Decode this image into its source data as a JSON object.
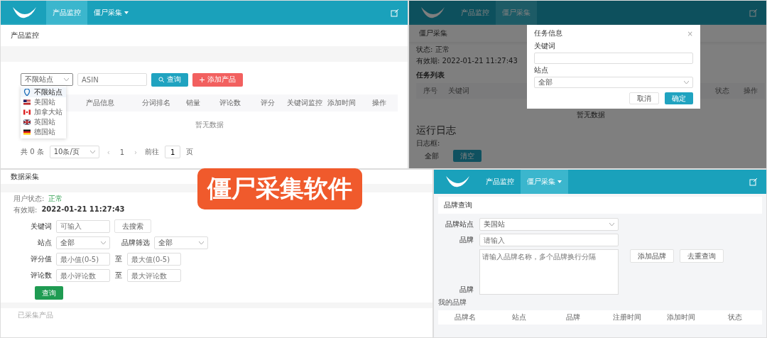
{
  "product_monitor": {
    "nav": [
      {
        "label": "产品监控",
        "selected": true,
        "dropdown": false
      },
      {
        "label": "僵尸采集",
        "selected": false,
        "dropdown": true
      }
    ],
    "breadcrumb": "产品监控",
    "site_select": {
      "value": "不限站点"
    },
    "asin_field": {
      "placeholder": "ASIN"
    },
    "buttons": [
      {
        "label": "查询",
        "kind": "search"
      },
      {
        "label": "添加产品",
        "kind": "add"
      }
    ],
    "site_menu": [
      {
        "label": "不限站点",
        "selected": true
      },
      {
        "label": "美国站",
        "selected": false
      },
      {
        "label": "加拿大站",
        "selected": false
      },
      {
        "label": "英国站",
        "selected": false
      },
      {
        "label": "德国站",
        "selected": false
      }
    ],
    "table": {
      "columns": [
        "产品信息",
        "分词排名",
        "销量",
        "评论数",
        "评分",
        "关键词监控",
        "添加时间",
        "操作"
      ],
      "empty_text": "暂无数据"
    },
    "pagination": {
      "total": "共 0 条",
      "page_size": "10条/页",
      "prev": "‹",
      "page": "1",
      "next": "›",
      "goto": "前往",
      "goto_value": "1",
      "page_unit": "页"
    }
  },
  "zombie_collect": {
    "header": "数据采集",
    "status_label": "用户状态:",
    "status_value": "正常",
    "expiry_label": "有效期:",
    "expiry_value": "2022-01-21 11:27:43",
    "form": [
      [
        {
          "kind": "label",
          "text": "关键词"
        },
        {
          "kind": "input",
          "placeholder": "可输入"
        },
        {
          "kind": "button",
          "text": "去搜索"
        }
      ],
      [
        {
          "kind": "label",
          "text": "站点"
        },
        {
          "kind": "select",
          "text": "全部"
        },
        {
          "kind": "label",
          "text": "品牌筛选"
        },
        {
          "kind": "select",
          "text": "全部"
        }
      ],
      [
        {
          "kind": "label",
          "text": "评分值"
        },
        {
          "kind": "input",
          "placeholder": "最小值(0-5)"
        },
        {
          "kind": "sep",
          "text": "至"
        },
        {
          "kind": "input",
          "placeholder": "最大值(0-5)"
        }
      ],
      [
        {
          "kind": "label",
          "text": "评论数"
        },
        {
          "kind": "input",
          "placeholder": "最小评论数"
        },
        {
          "kind": "sep",
          "text": "至"
        },
        {
          "kind": "input",
          "placeholder": "最大评论数"
        }
      ]
    ],
    "submit": "查询",
    "footer": "已采集产品"
  },
  "task_view": {
    "nav": [
      {
        "label": "产品监控",
        "selected": false,
        "dropdown": false
      },
      {
        "label": "僵尸采集",
        "selected": true,
        "dropdown": false
      }
    ],
    "header": "僵尸采集",
    "status": "状态: 正常",
    "expiry": "有效期: 2022-01-21 11:27:43",
    "list_title": "任务列表",
    "table": {
      "columns": [
        "序号",
        "关键词",
        "状态",
        "操作"
      ],
      "empty_text": "暂无数据"
    },
    "log_title": "运行日志",
    "log_label": "日志框:",
    "log_value": "全部",
    "log_button": "清空",
    "dialog": {
      "title": "任务信息",
      "close": "×",
      "keyword_label": "关键词",
      "site_label": "站点",
      "site_value": "全部",
      "buttons": [
        {
          "label": "取消",
          "kind": "cancel"
        },
        {
          "label": "确定",
          "kind": "confirm"
        }
      ]
    }
  },
  "brand_query": {
    "nav": [
      {
        "label": "产品监控",
        "selected": false,
        "dropdown": false
      },
      {
        "label": "僵尸采集",
        "selected": true,
        "dropdown": true
      }
    ],
    "header": "品牌查询",
    "site_label": "品牌站点",
    "site_value": "美国站",
    "brand_label": "品牌",
    "brand_placeholder": "请输入",
    "textarea_placeholder": "请输入品牌名称，多个品牌换行分隔",
    "textarea_label": "品牌",
    "buttons": [
      "添加品牌",
      "去重查询"
    ],
    "list_title": "我的品牌",
    "table": {
      "columns": [
        "品牌名",
        "站点",
        "品牌",
        "注册时间",
        "添加时间",
        "状态"
      ]
    }
  },
  "banner": {
    "text": "僵尸采集软件"
  }
}
